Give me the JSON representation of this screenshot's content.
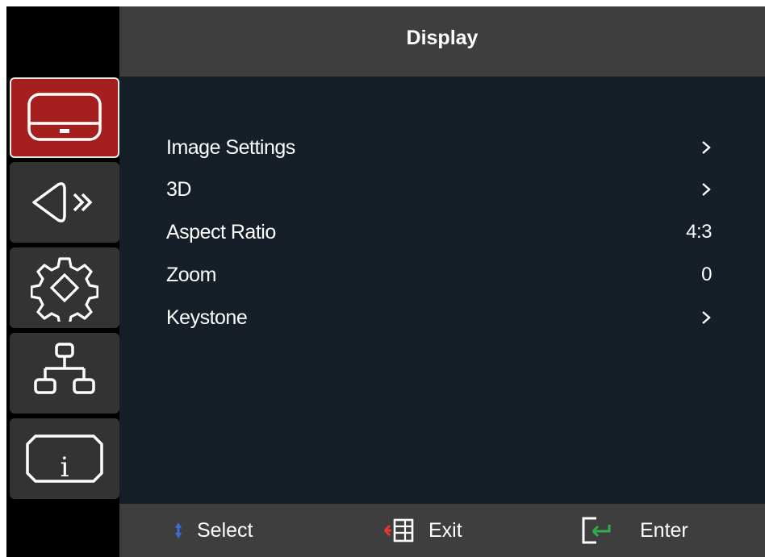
{
  "header": {
    "title": "Display"
  },
  "sidebar": {
    "items": [
      {
        "name": "display",
        "icon": "display-icon",
        "active": true
      },
      {
        "name": "audio",
        "icon": "speaker-icon",
        "active": false
      },
      {
        "name": "setup",
        "icon": "gear-icon",
        "active": false
      },
      {
        "name": "network",
        "icon": "network-icon",
        "active": false
      },
      {
        "name": "info",
        "icon": "info-icon",
        "active": false
      }
    ]
  },
  "menu": {
    "items": [
      {
        "label": "Image Settings",
        "value": "",
        "submenu": true
      },
      {
        "label": "3D",
        "value": "",
        "submenu": true
      },
      {
        "label": "Aspect Ratio",
        "value": "4:3",
        "submenu": false
      },
      {
        "label": "Zoom",
        "value": "0",
        "submenu": false
      },
      {
        "label": "Keystone",
        "value": "",
        "submenu": true
      }
    ]
  },
  "footer": {
    "select_label": "Select",
    "exit_label": "Exit",
    "enter_label": "Enter"
  },
  "colors": {
    "active_tab": "#a51f1f",
    "panel_bg": "#161e27",
    "bar_bg": "#3e3e3e",
    "select_icon": "#3b6fd6",
    "exit_arrow": "#e53935",
    "enter_arrow": "#2eae4a"
  }
}
